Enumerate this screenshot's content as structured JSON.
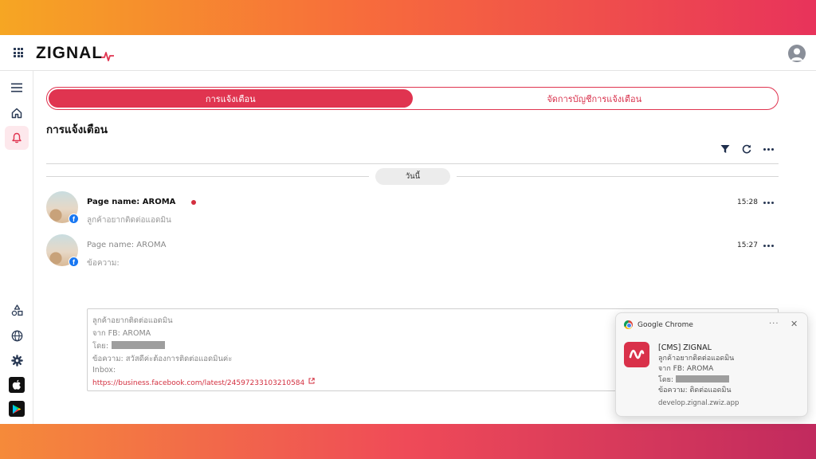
{
  "header": {
    "logo_text": "ZIGNAL",
    "brand_color": "#e03450"
  },
  "sidebar": {
    "top_items": [
      {
        "icon": "menu-icon"
      },
      {
        "icon": "home-icon"
      },
      {
        "icon": "bell-icon",
        "active": true
      }
    ],
    "bottom_items": [
      {
        "icon": "shapes-icon"
      },
      {
        "icon": "globe-icon"
      },
      {
        "icon": "gear-icon"
      },
      {
        "icon": "apple-app-store-icon"
      },
      {
        "icon": "google-play-icon"
      }
    ]
  },
  "tabs": [
    {
      "label": "การแจ้งเตือน",
      "active": true
    },
    {
      "label": "จัดการบัญชีการแจ้งเตือน",
      "active": false
    }
  ],
  "page_title": "การแจ้งเตือน",
  "toolbar": {
    "icons": [
      "filter-icon",
      "refresh-icon",
      "more-icon"
    ]
  },
  "date_divider": "วันนี้",
  "messages": [
    {
      "page_name": "Page name: AROMA",
      "preview": "ลูกค้าอยากติดต่อแอดมิน",
      "time": "15:28",
      "unread": true
    },
    {
      "page_name": "Page name: AROMA",
      "preview": "ข้อความ:",
      "time": "15:27",
      "unread": false,
      "detail": {
        "line1": "ลูกค้าอยากติดต่อแอดมิน",
        "line2": "จาก FB: AROMA",
        "line3_label": "โดย:",
        "line4": "ข้อความ: สวัสดีค่ะต้องการติดต่อแอดมินค่ะ",
        "line5": "Inbox:",
        "link": "https://business.facebook.com/latest/24597233103210584"
      }
    }
  ],
  "toast": {
    "source": "Google Chrome",
    "title": "[CMS] ZIGNAL",
    "line1": "ลูกค้าอยากติดต่อแอดมิน",
    "line2": "จาก FB: AROMA",
    "line3_label": "โดย:",
    "line4": "ข้อความ: ติดต่อแอดมิน",
    "site": "develop.zignal.zwiz.app"
  }
}
